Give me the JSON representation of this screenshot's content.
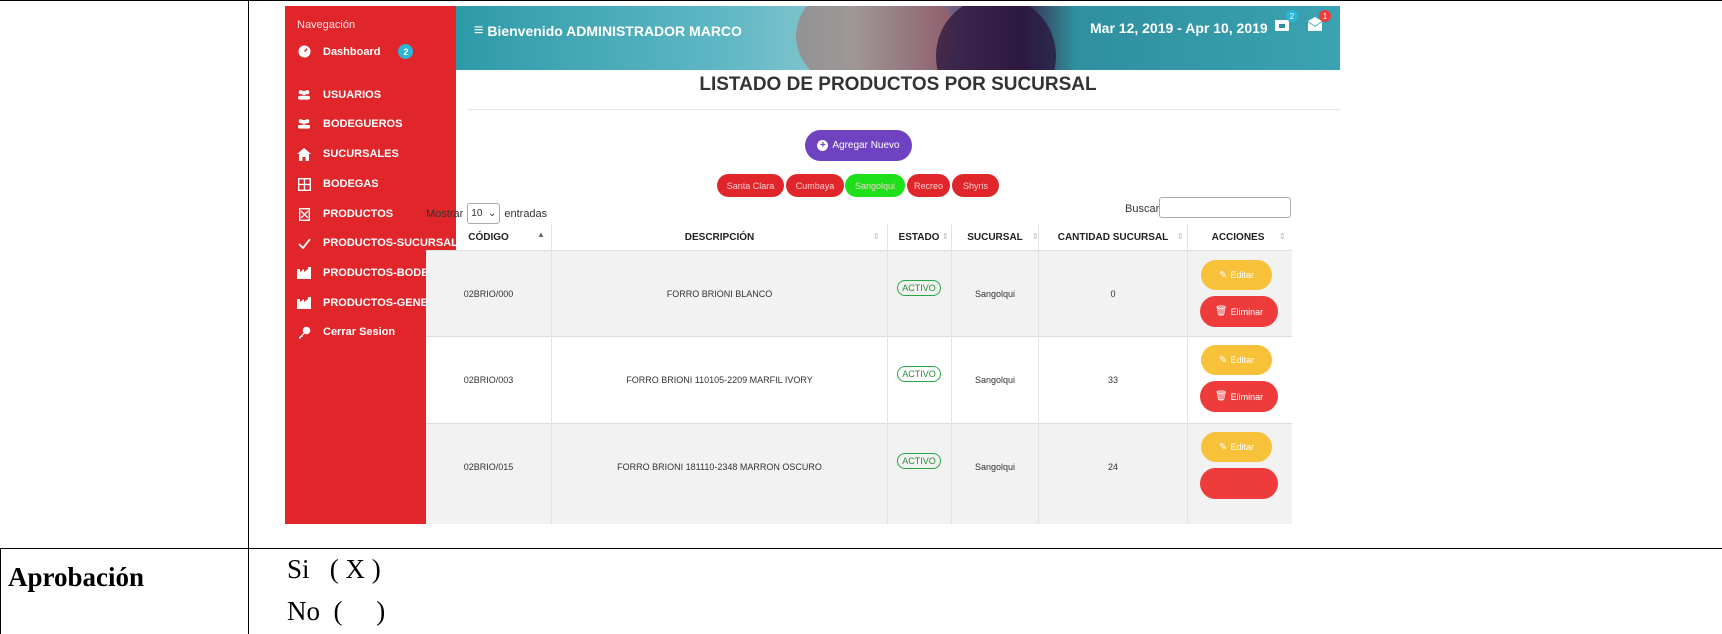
{
  "doc": {
    "approval_label": "Aprobación",
    "approval_yes": "Si   ( X )",
    "approval_no": "No  (     )"
  },
  "app": {
    "sidebar": {
      "nav_label": "Navegación",
      "items": [
        {
          "label": "Dashboard",
          "icon": "dashboard-icon",
          "badge": "2"
        },
        {
          "label": "USUARIOS",
          "icon": "users-icon"
        },
        {
          "label": "BODEGUEROS",
          "icon": "users-icon"
        },
        {
          "label": "SUCURSALES",
          "icon": "home-icon"
        },
        {
          "label": "BODEGAS",
          "icon": "grid-icon"
        },
        {
          "label": "PRODUCTOS",
          "icon": "box-icon"
        },
        {
          "label": "PRODUCTOS-SUCURSAL",
          "icon": "check-icon"
        },
        {
          "label": "PRODUCTOS-BODEGA",
          "icon": "factory-icon"
        },
        {
          "label": "PRODUCTOS-GENERAL",
          "icon": "factory-icon"
        },
        {
          "label": "Cerrar Sesion",
          "icon": "key-icon"
        }
      ]
    },
    "header": {
      "welcome": "Bienvenido ADMINISTRADOR MARCO",
      "date_range": "Mar 12, 2019 - Apr 10, 2019",
      "notif_badge_1": "2",
      "notif_badge_2": "1"
    },
    "page_title": "LISTADO DE PRODUCTOS POR SUCURSAL",
    "add_button": "Agregar Nuevo",
    "branches": [
      {
        "label": "Santa Clara",
        "color": "#e0262a"
      },
      {
        "label": "Cumbaya",
        "color": "#e0262a"
      },
      {
        "label": "Sangolqui",
        "color": "#1ee01a"
      },
      {
        "label": "Recreo",
        "color": "#e0262a"
      },
      {
        "label": "Shyris",
        "color": "#e0262a"
      }
    ],
    "show_prefix": "Mostrar",
    "show_value": "10",
    "show_suffix": "entradas",
    "search_label": "Buscar:",
    "table": {
      "headers": [
        "CÓDIGO",
        "DESCRIPCIÓN",
        "ESTADO",
        "SUCURSAL",
        "CANTIDAD SUCURSAL",
        "ACCIONES"
      ],
      "rows": [
        {
          "code": "02BRIO/000",
          "desc": "FORRO BRIONI  BLANCO",
          "status": "ACTIVO",
          "branch": "Sangolqui",
          "qty": "0"
        },
        {
          "code": "02BRIO/003",
          "desc": "FORRO BRIONI 110105-2209 MARFIL IVORY",
          "status": "ACTIVO",
          "branch": "Sangolqui",
          "qty": "33"
        },
        {
          "code": "02BRIO/015",
          "desc": "FORRO BRIONI 181110-2348 MARRON OSCURO",
          "status": "ACTIVO",
          "branch": "Sangolqui",
          "qty": "24"
        }
      ],
      "edit_label": "Editar",
      "delete_label": "Eliminar"
    }
  }
}
